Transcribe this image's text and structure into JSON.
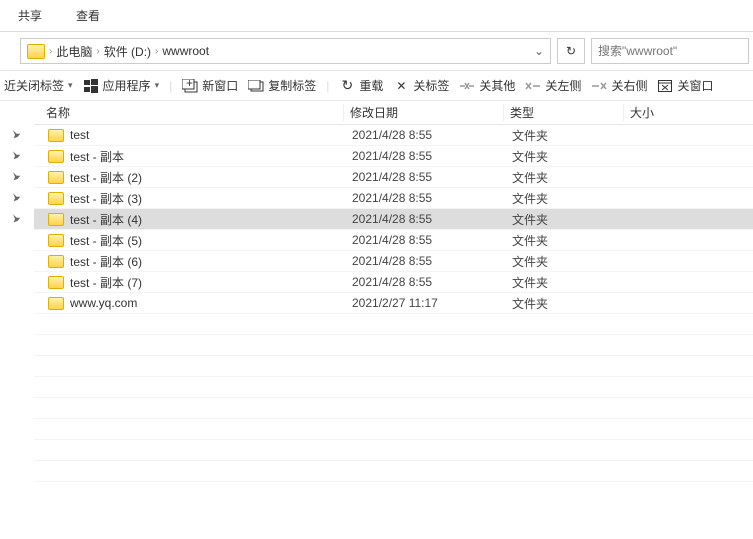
{
  "ribbon": {
    "share": "共享",
    "view": "查看"
  },
  "breadcrumb": {
    "pc": "此电脑",
    "drive": "软件 (D:)",
    "folder": "wwwroot"
  },
  "search": {
    "placeholder": "搜索\"wwwroot\""
  },
  "toolbar": {
    "recent_closed": "近关闭标签",
    "apps": "应用程序",
    "new_window": "新窗口",
    "copy_tab": "复制标签",
    "reload": "重载",
    "close_tab": "关标签",
    "close_other": "关其他",
    "close_left": "关左侧",
    "close_right": "关右侧",
    "close_window": "关窗口"
  },
  "columns": {
    "name": "名称",
    "date": "修改日期",
    "type": "类型",
    "size": "大小"
  },
  "rows": [
    {
      "name": "test",
      "date": "2021/4/28 8:55",
      "type": "文件夹",
      "pinned": true,
      "selected": false
    },
    {
      "name": "test - 副本",
      "date": "2021/4/28 8:55",
      "type": "文件夹",
      "pinned": true,
      "selected": false
    },
    {
      "name": "test - 副本 (2)",
      "date": "2021/4/28 8:55",
      "type": "文件夹",
      "pinned": true,
      "selected": false
    },
    {
      "name": "test - 副本 (3)",
      "date": "2021/4/28 8:55",
      "type": "文件夹",
      "pinned": true,
      "selected": false
    },
    {
      "name": "test - 副本 (4)",
      "date": "2021/4/28 8:55",
      "type": "文件夹",
      "pinned": true,
      "selected": true
    },
    {
      "name": "test - 副本 (5)",
      "date": "2021/4/28 8:55",
      "type": "文件夹",
      "pinned": false,
      "selected": false
    },
    {
      "name": "test - 副本 (6)",
      "date": "2021/4/28 8:55",
      "type": "文件夹",
      "pinned": false,
      "selected": false
    },
    {
      "name": "test - 副本 (7)",
      "date": "2021/4/28 8:55",
      "type": "文件夹",
      "pinned": false,
      "selected": false
    },
    {
      "name": "www.yq.com",
      "date": "2021/2/27 11:17",
      "type": "文件夹",
      "pinned": false,
      "selected": false
    }
  ],
  "empty_rows": 8
}
